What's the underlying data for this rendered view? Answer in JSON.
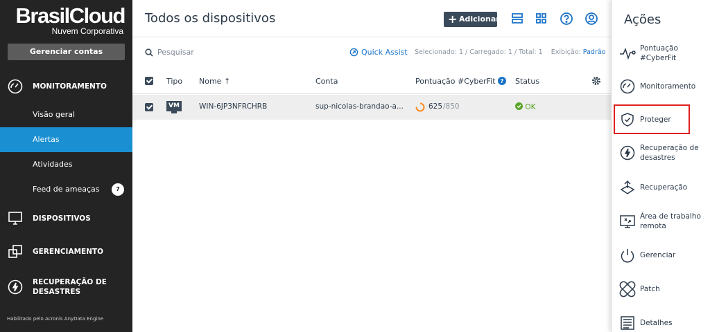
{
  "brand": {
    "name": "BrasilCloud",
    "subtitle": "Nuvem Corporativa"
  },
  "sidebar": {
    "manage_button": "Gerenciar contas",
    "sections": {
      "monitoring": {
        "label": "MONITORAMENTO",
        "icon": "gauge-icon"
      },
      "devices": {
        "label": "DISPOSITIVOS",
        "icon": "monitor-icon"
      },
      "management": {
        "label": "GERENCIAMENTO",
        "icon": "stacked-windows-icon"
      },
      "recovery": {
        "label1": "RECUPERAÇÃO DE",
        "label2": "DESASTRES",
        "icon": "lightning-circle-icon"
      }
    },
    "items": [
      {
        "label": "Visão geral",
        "active": false
      },
      {
        "label": "Alertas",
        "active": true
      },
      {
        "label": "Atividades",
        "active": false
      },
      {
        "label": "Feed de ameaças",
        "active": false,
        "badge": "7"
      }
    ],
    "footer": "Habilitado pelo Acronis AnyData Engine"
  },
  "main": {
    "title": "Todos os dispositivos",
    "add_button": "Adicionar",
    "search_placeholder": "Pesquisar",
    "quick_assist": "Quick Assist",
    "selection_info": "Selecionado: 1 / Carregado: 1 / Total: 1",
    "view_label": "Exibição:",
    "view_value": "Padrão",
    "columns": {
      "type": "Tipo",
      "name": "Nome",
      "account": "Conta",
      "score": "Pontuação #CyberFit",
      "status": "Status"
    },
    "rows": [
      {
        "type": "VM",
        "name": "WIN-6JP3NFRCHRB",
        "account": "sup-nicolas-brandao-a...",
        "score": "625",
        "score_max": "/850",
        "status": "OK"
      }
    ]
  },
  "actions": {
    "title": "Ações",
    "items": [
      {
        "label": "Pontuação #CyberFit",
        "icon": "pulse-icon"
      },
      {
        "label": "Monitoramento",
        "icon": "gauge-icon"
      },
      {
        "label": "Proteger",
        "icon": "shield-check-icon"
      },
      {
        "label": "Recuperação de desastres",
        "icon": "lightning-circle-icon"
      },
      {
        "label": "Recuperação",
        "icon": "recovery-arrows-icon"
      },
      {
        "label": "Área de trabalho remota",
        "icon": "remote-desktop-icon"
      },
      {
        "label": "Gerenciar",
        "icon": "power-icon"
      },
      {
        "label": "Patch",
        "icon": "patch-icon"
      },
      {
        "label": "Detalhes",
        "icon": "details-icon"
      }
    ]
  },
  "colors": {
    "sidebar": "#242424",
    "accent": "#1a8fd1",
    "ok": "#5aa52a",
    "highlight": "#e02020"
  }
}
